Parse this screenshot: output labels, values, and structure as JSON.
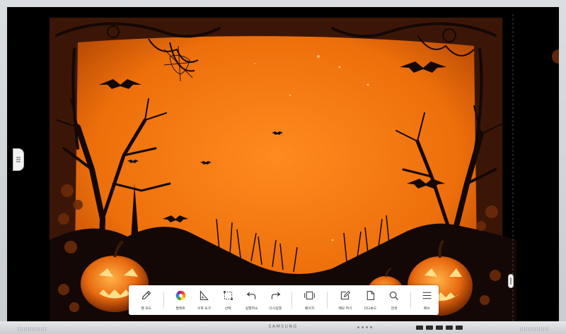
{
  "window": {
    "brand": "SAMSUNG"
  },
  "colors": {
    "bg_orange": "#f07a12",
    "silhouette": "#140806",
    "toolbar_bg": "#ffffff"
  },
  "toolbar": {
    "pen_mode": "펜 모드",
    "palette": "팔레트",
    "math_tools": "수학 도구",
    "select": "선택",
    "undo": "실행취소",
    "redo": "다시실행",
    "page": "페이지",
    "memo": "메모 켜기",
    "whiteboard": "더니보드",
    "search": "검색",
    "menu": "메뉴"
  },
  "icons": [
    "pen-icon",
    "palette-icon",
    "ruler-icon",
    "select-icon",
    "undo-icon",
    "redo-icon",
    "page-icon",
    "memo-icon",
    "document-icon",
    "search-icon",
    "menu-icon",
    "drawer-handle-icon"
  ]
}
